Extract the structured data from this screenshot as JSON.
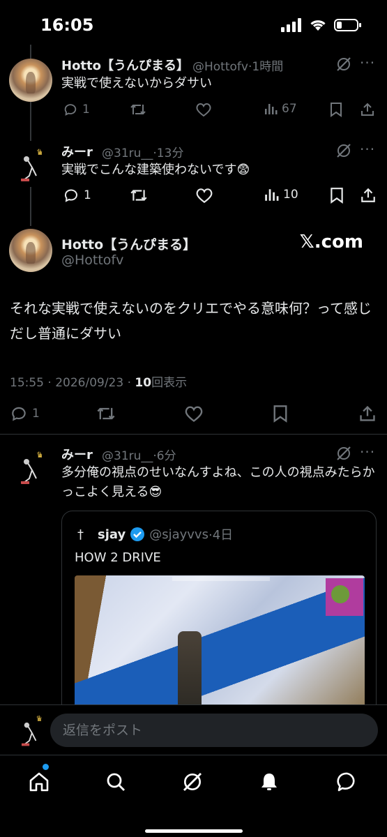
{
  "status_bar": {
    "time": "16:05"
  },
  "tweets": [
    {
      "name": "Hotto【うんぴまる】",
      "handle": "@Hottofv",
      "time": "·1時間",
      "text": "実戦で使えないからダサい",
      "replies": "1",
      "views": "67"
    },
    {
      "name": "みーr",
      "handle": "@31ru__",
      "time": "·13分",
      "text": "実戦でこんな建築使わないです😨",
      "replies": "1",
      "views": "10"
    }
  ],
  "main_tweet": {
    "name": "Hotto【うんぴまる】",
    "handle": "@Hottofv",
    "watermark": "𝕏.com",
    "text": "それな実戦で使えないのをクリエでやる意味何？って感じだし普通にダサい",
    "timestamp": "15:55 · 2026/09/23 · ",
    "view_count": "10",
    "views_label": "回表示",
    "replies": "1"
  },
  "reply_tweet": {
    "name": "みーr",
    "handle": "@31ru__",
    "time": "·6分",
    "text": "多分俺の視点のせいなんすよね、この人の視点みたらかっこよく見える😎",
    "quote": {
      "dagger": "†",
      "name": "sjay",
      "handle": "@sjayvvs",
      "time": "·4日",
      "text": "HOW 2 DRIVE"
    }
  },
  "reply_bar": {
    "placeholder": "返信をポスト"
  },
  "colors": {
    "accent": "#1d9bf0",
    "verified": "#1d9bf0",
    "muted": "#71767b",
    "background": "#000000"
  },
  "icons": [
    "reply-icon",
    "retweet-icon",
    "like-icon",
    "views-icon",
    "bookmark-icon",
    "share-icon",
    "grok-icon",
    "more-icon",
    "home-icon",
    "search-icon",
    "notifications-icon",
    "messages-icon"
  ]
}
